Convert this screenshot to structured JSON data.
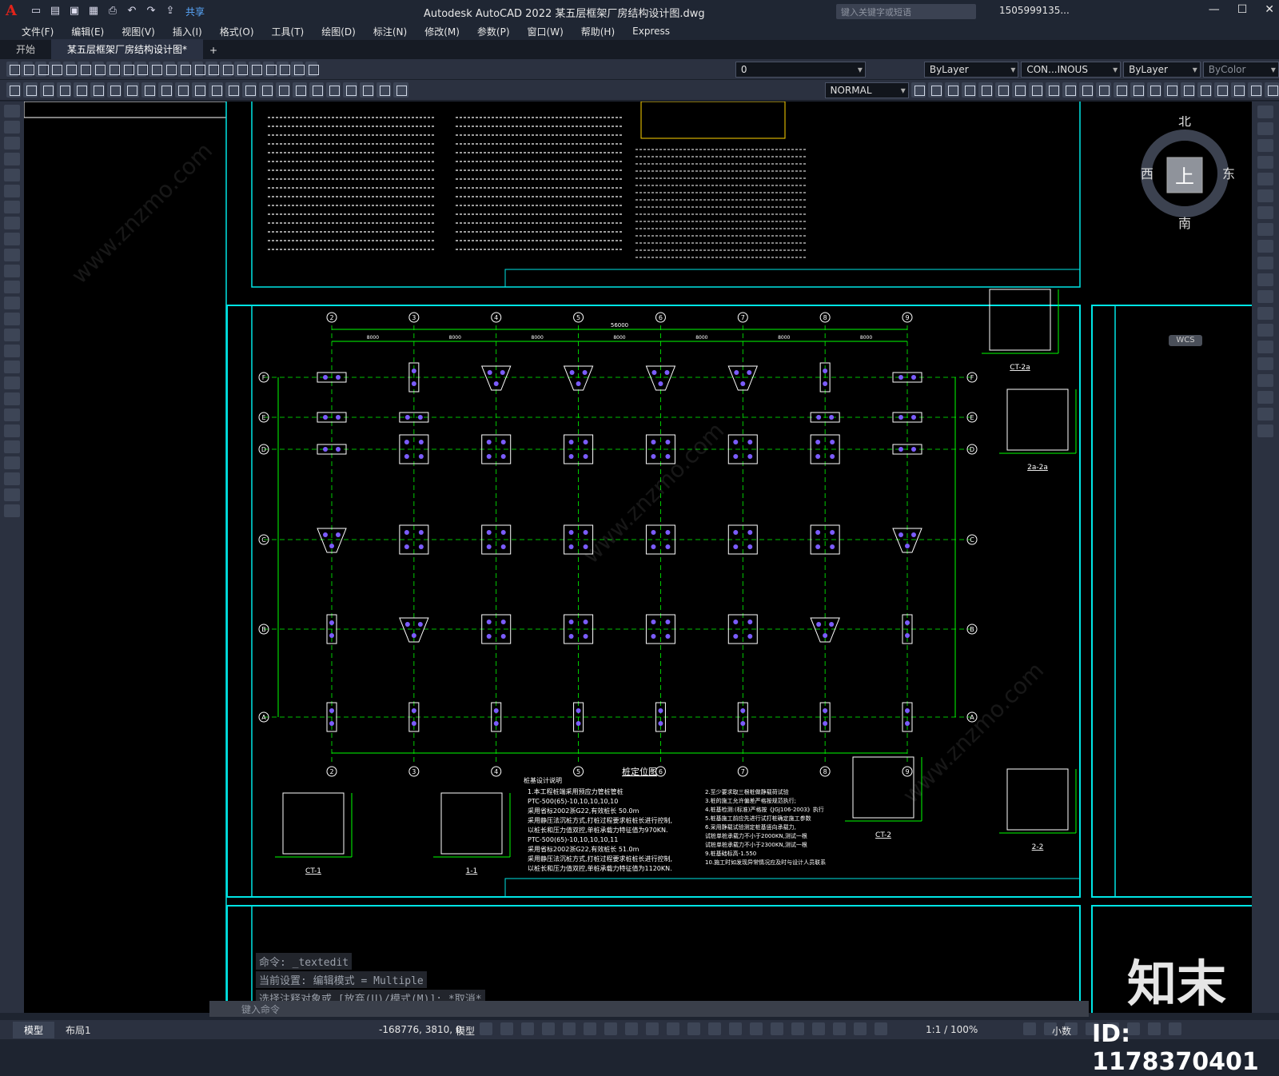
{
  "app": {
    "window_title": "Autodesk AutoCAD 2022    某五层框架厂房结构设计图.dwg",
    "search_placeholder": "键入关键字或短语",
    "user": "1505999135...",
    "share": "共享"
  },
  "menu": [
    "文件(F)",
    "编辑(E)",
    "视图(V)",
    "插入(I)",
    "格式(O)",
    "工具(T)",
    "绘图(D)",
    "标注(N)",
    "修改(M)",
    "参数(P)",
    "窗口(W)",
    "帮助(H)",
    "Express"
  ],
  "tabs": [
    {
      "label": "开始",
      "active": false
    },
    {
      "label": "某五层框架厂房结构设计图*",
      "active": true
    }
  ],
  "toolbar": {
    "layer": "0",
    "linetype_color": "ByLayer",
    "linetype": "CON...INOUS",
    "lineweight": "ByLayer",
    "plotstyle": "ByColor",
    "text_style": "NORMAL"
  },
  "viewcube": {
    "north": "北",
    "south": "南",
    "east": "东",
    "west": "西",
    "face": "上",
    "wcs": "WCS"
  },
  "drawing": {
    "plan_title": "桩定位图",
    "notes_title": "桩基设计说明",
    "dim_total": "56000",
    "dim_bay": "8000",
    "grid_cols": [
      "2",
      "3",
      "4",
      "5",
      "6",
      "7",
      "8",
      "9"
    ],
    "grid_rows": [
      "F",
      "E",
      "D",
      "C",
      "B",
      "A"
    ],
    "details": [
      "CT-1",
      "1-1",
      "CT-2",
      "2-2",
      "CT-2a",
      "2a-2a"
    ],
    "notes": [
      "1.本工程桩端采用预应力管桩管桩",
      "PTC-500(65)-10,10,10,10,10",
      "采用省标2002浙G22,有效桩长 50.0m",
      "采用静压法沉桩方式,打桩过程要求桩桩长进行控制,",
      "以桩长和压力值双控,单桩承载力特征值为970KN.",
      "PTC-500(65)-10,10,10,10,11",
      "采用省标2002浙G22,有效桩长 51.0m",
      "采用静压法沉桩方式,打桩过程要求桩桩长进行控制,",
      "以桩长和压力值双控,单桩承载力特征值为1120KN."
    ],
    "notes_right": [
      "2.至少要求取三根桩做静载荷试验",
      "3.桩的施工允许偏差严格按规范执行;",
      "4.桩基检测:(标准)严格按《JGJ106-2003》执行",
      "5.桩基施工前应先进行试打桩确定施工参数",
      "6.采用静载试验测定桩基竖向承载力,",
      "试桩单桩承载力不小于2000KN,测试一根",
      "试桩单桩承载力不小于2300KN,测试一根",
      "9.桩基础标高-1.550",
      "10.施工时如发现异常情况应及时与设计人员联系"
    ]
  },
  "command": {
    "history": [
      "命令: _textedit",
      "当前设置: 编辑模式 = Multiple",
      "选择注释对象或 [放弃(U)/模式(M)]: *取消*"
    ],
    "input_placeholder": "键入命令"
  },
  "status": {
    "tabs": [
      {
        "label": "模型",
        "active": true
      },
      {
        "label": "布局1",
        "active": false
      }
    ],
    "coords": "-168776, 3810, 0",
    "mode": "模型",
    "scale": "1:1 / 100%",
    "units": "小数"
  },
  "watermark": {
    "brand": "知末",
    "id": "ID: 1178370401",
    "site": "www.znzmo.com"
  },
  "colors": {
    "accent": "#00e5e5",
    "grid_line": "#00ff00",
    "pile": "#7b5cff",
    "background": "#000000"
  }
}
